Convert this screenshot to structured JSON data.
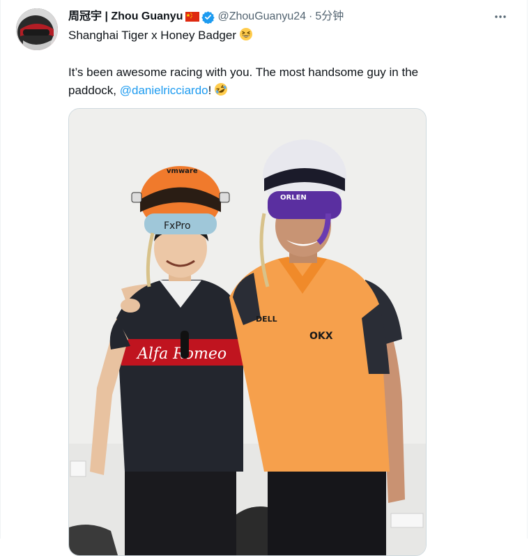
{
  "tweet": {
    "display_name": "周冠宇 | Zhou Guanyu",
    "handle": "@ZhouGuanyu24",
    "separator": "·",
    "time": "5分钟",
    "line1": "Shanghai Tiger x Honey Badger",
    "line2": "It’s been awesome racing with you. The most handsome guy in the",
    "line3_prefix": "paddock, ",
    "mention": "@danielricciardo",
    "line3_suffix": "!"
  },
  "icons": {
    "flag": "china-flag-icon",
    "verified": "verified-badge-icon",
    "more": "more-options-icon",
    "emoji1": "grinning-squinting-face-emoji",
    "emoji2": "rolling-on-floor-laughing-emoji"
  },
  "colors": {
    "mention": "#1d9bf0",
    "verified": "#1d9bf0",
    "secondary_text": "#536471"
  }
}
